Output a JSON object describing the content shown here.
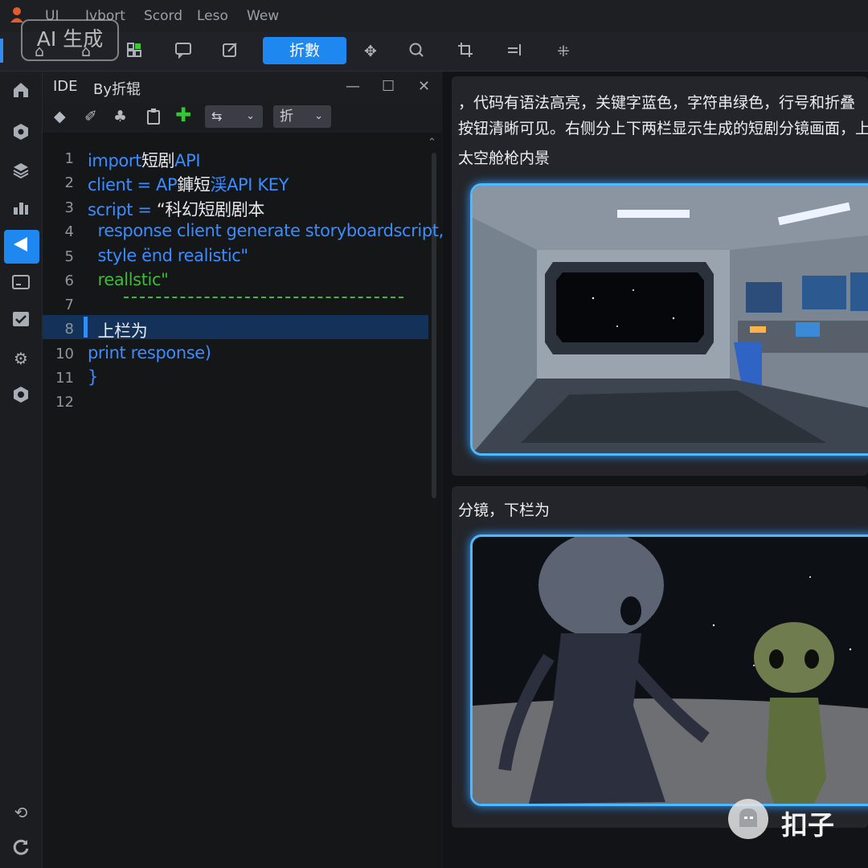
{
  "menubar": {
    "items": [
      "UI",
      "Ivbort",
      "Scord",
      "Leso",
      "Wew"
    ]
  },
  "watermark": {
    "badge": "AI 生成",
    "brand": "扣子"
  },
  "toolbar": {
    "primary_label": "折數",
    "icons": [
      "home-icon",
      "home-alt-icon",
      "layout-icon",
      "chat-icon",
      "edit-icon",
      "transform-icon",
      "search-icon",
      "crop-icon",
      "align-icon",
      "sparkle-icon"
    ]
  },
  "sidebar": {
    "icons": [
      "home-icon",
      "hexagon-icon",
      "layers-icon",
      "chart-icon",
      "send-icon",
      "terminal-icon",
      "check-icon",
      "gear-icon",
      "gear-alt-icon",
      "refresh-icon",
      "sync-icon"
    ],
    "active_index": 4
  },
  "editor": {
    "tab_ide": "IDE",
    "tab_file": "By折辊",
    "dropdown1": "",
    "dropdown2": "折",
    "lines": [
      {
        "num": "1",
        "parts": [
          {
            "t": "import",
            "c": "kw"
          },
          {
            "t": "短剧",
            "c": "wh"
          },
          {
            "t": "API",
            "c": "kw"
          }
        ]
      },
      {
        "num": "2",
        "parts": [
          {
            "t": "client = AP",
            "c": "kw"
          },
          {
            "t": "龲短",
            "c": "wh"
          },
          {
            "t": "渓API KEY",
            "c": "kw"
          }
        ]
      },
      {
        "num": "3",
        "parts": [
          {
            "t": "script = ",
            "c": "kw"
          },
          {
            "t": "“科幻短剧剧本",
            "c": "wh"
          }
        ]
      },
      {
        "num": "4",
        "parts": [
          {
            "t": "  response client generate storyboardscript,",
            "c": "kw"
          }
        ]
      },
      {
        "num": "5",
        "parts": [
          {
            "t": "  style ënd realistic\"",
            "c": "kw"
          }
        ]
      },
      {
        "num": "6",
        "parts": [
          {
            "t": "  reallstic\"",
            "c": "str"
          }
        ]
      },
      {
        "num": "7",
        "parts": []
      },
      {
        "num": "8",
        "parts": [
          {
            "t": "  上栏为",
            "c": "wh"
          }
        ]
      },
      {
        "num": "10",
        "parts": [
          {
            "t": "print response)",
            "c": "kw"
          }
        ]
      },
      {
        "num": "11",
        "parts": [
          {
            "t": "}",
            "c": "kw"
          }
        ]
      },
      {
        "num": "12",
        "parts": []
      }
    ]
  },
  "right_panel": {
    "description_line1": "，代码有语法高亮，关键字蓝色，字符串绿色，行号和折叠",
    "description_line2": "按钮清晰可见。右侧分上下两栏显示生成的短剧分镜画面，上",
    "shot1_caption": "太空舱枪内景",
    "shot2_caption": "分镜，下栏为"
  }
}
